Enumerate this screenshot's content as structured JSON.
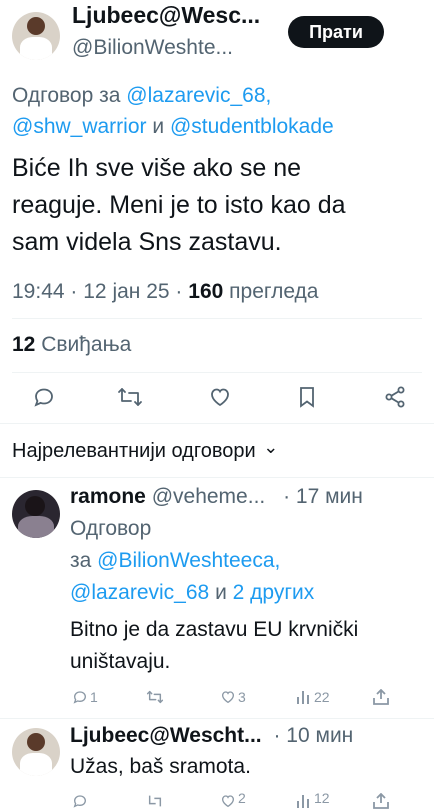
{
  "tweet": {
    "author_name": "Ljubeec@Wesc...",
    "author_handle": "@BilionWeshte...",
    "follow_label": "Прати",
    "reply_prefix": "Одговор за",
    "reply_to_1": "@lazarevic_68,",
    "reply_to_2": "@shw_warrior",
    "reply_and": "и",
    "reply_to_3": "@studentblokade",
    "text_lines": [
      "Biće Ih sve više ako se ne",
      "reaguje. Meni je to isto kao da",
      "sam videla Sns zastavu."
    ],
    "time": "19:44",
    "sep1": "·",
    "date": "12 јан 25",
    "sep2": "·",
    "views_count": "160",
    "views_label": "прегледа",
    "likes_count": "12",
    "likes_label": "Свиђања"
  },
  "replies_header": {
    "label": "Најрелевантнији одговори",
    "chevron": "⌄"
  },
  "replies": [
    {
      "author_name": "ramone",
      "author_handle": "@veheme...",
      "time": "· 17 мин",
      "reply_line1": "Одговор",
      "reply_prefix": "за",
      "mention1": "@BilionWeshteeca,",
      "mention2": "@lazarevic_68",
      "and": "и",
      "others": "2 других",
      "text_lines": [
        "Bitno je da zastavu EU krvnički",
        "uništavaju."
      ],
      "reply_count": "1",
      "like_count": "3",
      "view_count": "22"
    },
    {
      "author_name": "Ljubeec@Wescht...",
      "time": "· 10 мин",
      "text": "Užas, baš sramota.",
      "like_count": "2",
      "view_count": "12"
    }
  ],
  "icons": {
    "reply": "reply-icon",
    "retweet": "retweet-icon",
    "like": "heart-icon",
    "bookmark": "bookmark-icon",
    "share": "share-icon",
    "views": "views-chart-icon"
  },
  "colors": {
    "accent": "#1d9bf0",
    "text": "#0f1419",
    "secondary": "#536471",
    "follow_bg": "#0f1419"
  }
}
